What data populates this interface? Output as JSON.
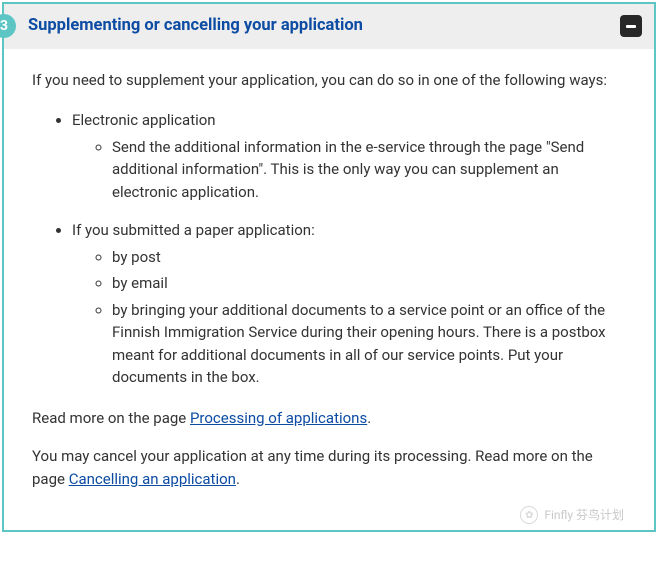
{
  "step": {
    "number": "3",
    "title": "Supplementing or cancelling your application"
  },
  "intro": "If you need to supplement your application, you can do so in one of the following ways:",
  "list": [
    {
      "label": "Electronic application",
      "sub": [
        "Send the additional information in the e-service through the page \"Send additional information\". This is the only way you can supplement an electronic application."
      ]
    },
    {
      "label": "If you submitted a paper application:",
      "sub": [
        "by post",
        "by email",
        "by bringing your additional documents to a service point or an office of the Finnish Immigration Service during their opening hours. There is a postbox meant for additional documents in all of our service points. Put your documents in the box."
      ]
    }
  ],
  "readmore_processing": {
    "prefix": "Read more on the page ",
    "link": "Processing of applications",
    "suffix": "."
  },
  "cancel_para": {
    "prefix": "You may cancel your application at any time during its processing. Read more on the page ",
    "link": "Cancelling an application",
    "suffix": "."
  },
  "watermark": "Finfly 芬鸟计划"
}
